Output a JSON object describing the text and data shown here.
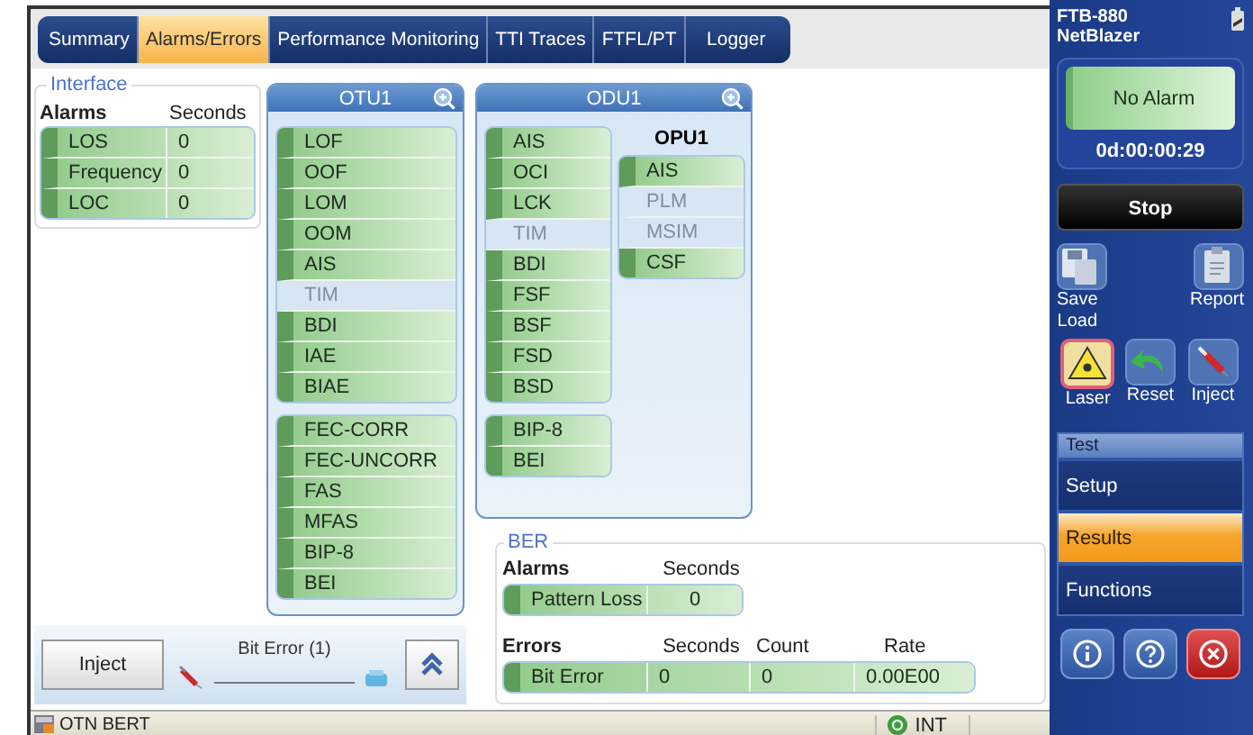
{
  "tabs": [
    {
      "label": "Summary",
      "selected": false
    },
    {
      "label": "Alarms/Errors",
      "selected": true
    },
    {
      "label": "Performance Monitoring",
      "selected": false
    },
    {
      "label": "TTI  Traces",
      "selected": false
    },
    {
      "label": "FTFL/PT",
      "selected": false
    },
    {
      "label": "Logger",
      "selected": false
    }
  ],
  "interface": {
    "legend": "Interface",
    "columns": [
      "Alarms",
      "Seconds"
    ],
    "rows": [
      {
        "name": "LOS",
        "seconds": "0"
      },
      {
        "name": "Frequency",
        "seconds": "0"
      },
      {
        "name": "LOC",
        "seconds": "0"
      }
    ]
  },
  "otu1": {
    "title": "OTU1",
    "groups": [
      {
        "alarms": [
          {
            "name": "LOF",
            "disabled": false
          },
          {
            "name": "OOF",
            "disabled": false
          },
          {
            "name": "LOM",
            "disabled": false
          },
          {
            "name": "OOM",
            "disabled": false
          },
          {
            "name": "AIS",
            "disabled": false
          },
          {
            "name": "TIM",
            "disabled": true
          },
          {
            "name": "BDI",
            "disabled": false
          },
          {
            "name": "IAE",
            "disabled": false
          },
          {
            "name": "BIAE",
            "disabled": false
          }
        ]
      },
      {
        "alarms": [
          {
            "name": "FEC-CORR",
            "disabled": false
          },
          {
            "name": "FEC-UNCORR",
            "disabled": false
          },
          {
            "name": "FAS",
            "disabled": false
          },
          {
            "name": "MFAS",
            "disabled": false
          },
          {
            "name": "BIP-8",
            "disabled": false
          },
          {
            "name": "BEI",
            "disabled": false
          }
        ]
      }
    ]
  },
  "odu1": {
    "title": "ODU1",
    "groups": [
      {
        "alarms": [
          {
            "name": "AIS",
            "disabled": false
          },
          {
            "name": "OCI",
            "disabled": false
          },
          {
            "name": "LCK",
            "disabled": false
          },
          {
            "name": "TIM",
            "disabled": true
          },
          {
            "name": "BDI",
            "disabled": false
          },
          {
            "name": "FSF",
            "disabled": false
          },
          {
            "name": "BSF",
            "disabled": false
          },
          {
            "name": "FSD",
            "disabled": false
          },
          {
            "name": "BSD",
            "disabled": false
          }
        ]
      },
      {
        "alarms": [
          {
            "name": "BIP-8",
            "disabled": false
          },
          {
            "name": "BEI",
            "disabled": false
          }
        ]
      }
    ],
    "opu1": {
      "title": "OPU1",
      "alarms": [
        {
          "name": "AIS",
          "disabled": false
        },
        {
          "name": "PLM",
          "disabled": true
        },
        {
          "name": "MSIM",
          "disabled": true
        },
        {
          "name": "CSF",
          "disabled": false
        }
      ]
    }
  },
  "inject": {
    "button": "Inject",
    "error_label": "Bit Error (1)"
  },
  "ber": {
    "legend": "BER",
    "alarm_columns": [
      "Alarms",
      "Seconds"
    ],
    "alarms": [
      {
        "name": "Pattern Loss",
        "seconds": "0"
      }
    ],
    "error_columns": [
      "Errors",
      "Seconds",
      "Count",
      "Rate"
    ],
    "errors": [
      {
        "name": "Bit Error",
        "seconds": "0",
        "count": "0",
        "rate": "0.00E00"
      }
    ]
  },
  "status_bar": {
    "test": "OTN BERT",
    "clock": "INT"
  },
  "side_panel": {
    "device": "FTB-880",
    "model": "NetBlazer",
    "alarm_status": "No Alarm",
    "timer": "0d:00:00:29",
    "stop": "Stop",
    "tools": [
      {
        "kind": "save",
        "label": "Save\nLoad",
        "on": false
      },
      {
        "kind": "report",
        "label": "Report",
        "on": false
      },
      {
        "kind": "laser",
        "label": "Laser",
        "on": true
      },
      {
        "kind": "reset",
        "label": "Reset",
        "on": false
      },
      {
        "kind": "inject",
        "label": "Inject",
        "on": false
      }
    ],
    "menu": {
      "title": "Test",
      "items": [
        {
          "label": "Setup",
          "selected": false
        },
        {
          "label": "Results",
          "selected": true
        },
        {
          "label": "Functions",
          "selected": false
        }
      ]
    },
    "buttons": [
      {
        "kind": "info"
      },
      {
        "kind": "help"
      },
      {
        "kind": "close"
      }
    ]
  }
}
